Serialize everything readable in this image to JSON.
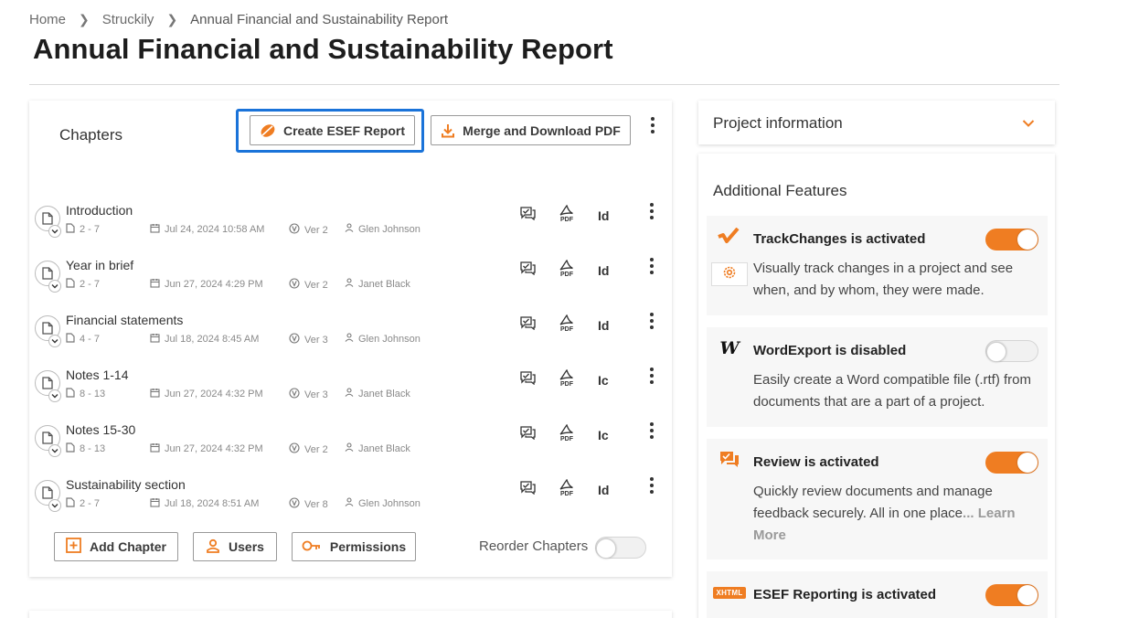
{
  "breadcrumb": {
    "items": [
      "Home",
      "Struckily",
      "Annual Financial and Sustainability Report"
    ]
  },
  "page": {
    "title": "Annual Financial and Sustainability Report"
  },
  "chapters_panel": {
    "title": "Chapters",
    "create_esef_label": "Create ESEF Report",
    "merge_pdf_label": "Merge and Download PDF",
    "chapters": [
      {
        "name": "Introduction",
        "pages": "2 - 7",
        "date": "Jul 24, 2024 10:58 AM",
        "version": "Ver 2",
        "user": "Glen Johnson",
        "code": "Id"
      },
      {
        "name": "Year in brief",
        "pages": "2 - 7",
        "date": "Jun 27, 2024 4:29 PM",
        "version": "Ver 2",
        "user": "Janet Black",
        "code": "Id"
      },
      {
        "name": "Financial statements",
        "pages": "4 - 7",
        "date": "Jul 18, 2024 8:45 AM",
        "version": "Ver 3",
        "user": "Glen Johnson",
        "code": "Id"
      },
      {
        "name": "Notes 1-14",
        "pages": "8 - 13",
        "date": "Jun 27, 2024 4:32 PM",
        "version": "Ver 3",
        "user": "Janet Black",
        "code": "Ic"
      },
      {
        "name": "Notes 15-30",
        "pages": "8 - 13",
        "date": "Jun 27, 2024 4:32 PM",
        "version": "Ver 2",
        "user": "Janet Black",
        "code": "Ic"
      },
      {
        "name": "Sustainability section",
        "pages": "2 - 7",
        "date": "Jul 18, 2024 8:51 AM",
        "version": "Ver 8",
        "user": "Glen Johnson",
        "code": "Id"
      }
    ],
    "pdf_label": "PDF",
    "add_chapter_label": "Add Chapter",
    "users_label": "Users",
    "permissions_label": "Permissions",
    "reorder_label": "Reorder Chapters",
    "reorder_enabled": false
  },
  "project_info": {
    "title": "Project information"
  },
  "features": {
    "title": "Additional Features",
    "items": [
      {
        "title": "TrackChanges is activated",
        "description": "Visually track changes in a project and see when, and by whom, they were made.",
        "enabled": true,
        "icon": "trackchanges-icon"
      },
      {
        "title": "WordExport is disabled",
        "description": "Easily create a Word compatible file (.rtf) from documents that are a part of a project.",
        "enabled": false,
        "icon": "word-icon"
      },
      {
        "title": "Review is activated",
        "description": "Quickly review documents and manage feedback securely. All in one place",
        "more": "... Learn More",
        "enabled": true,
        "icon": "review-icon"
      },
      {
        "title": "ESEF Reporting is activated",
        "enabled": true,
        "icon": "xhtml-icon",
        "badge": "XHTML"
      }
    ]
  },
  "colors": {
    "accent": "#ef7d22",
    "focus": "#1a73d9"
  }
}
